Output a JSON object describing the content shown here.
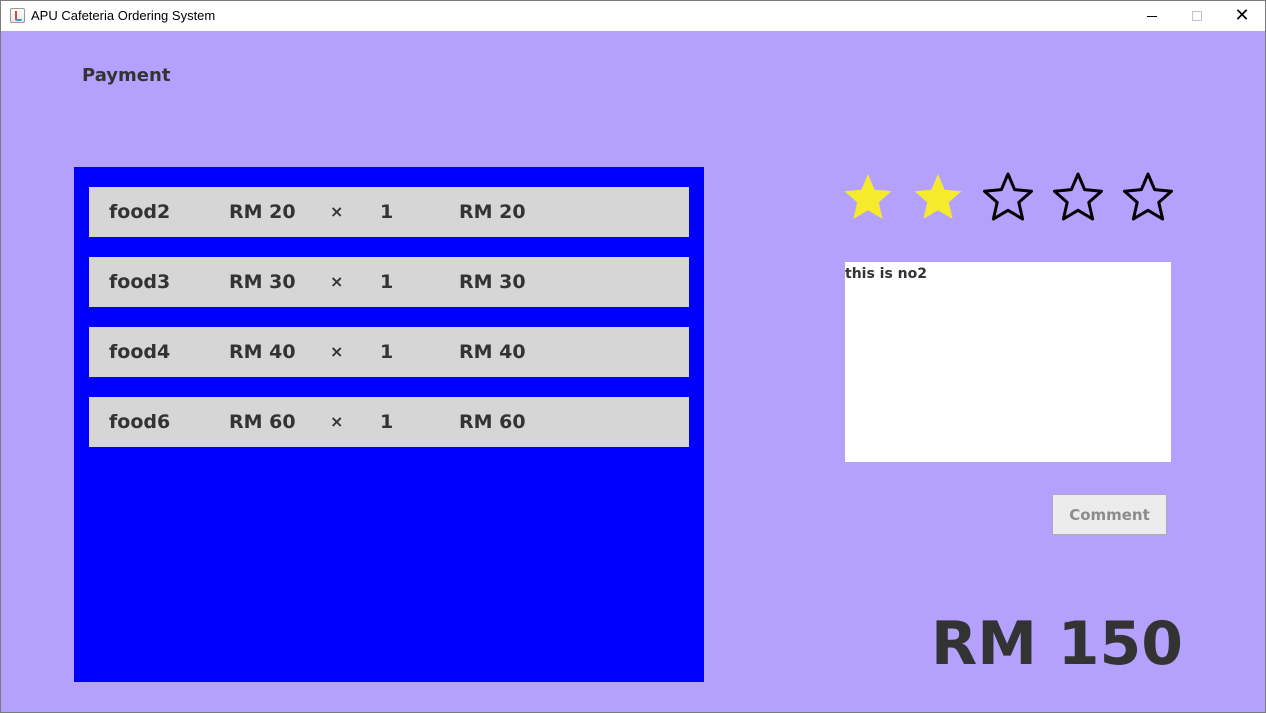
{
  "window": {
    "title": "APU Cafeteria Ordering System",
    "controls": {
      "minimize": "minimize-icon",
      "maximize": "maximize-icon",
      "close": "✕"
    },
    "background_color": "#b3a1fd"
  },
  "page": {
    "title": "Payment"
  },
  "order": {
    "panel_color": "#0000ff",
    "row_color": "#d6d6d6",
    "items": [
      {
        "name": "food2",
        "price": "RM 20",
        "times": "×",
        "qty": "1",
        "subtotal": "RM 20"
      },
      {
        "name": "food3",
        "price": "RM 30",
        "times": "×",
        "qty": "1",
        "subtotal": "RM 30"
      },
      {
        "name": "food4",
        "price": "RM 40",
        "times": "×",
        "qty": "1",
        "subtotal": "RM 40"
      },
      {
        "name": "food6",
        "price": "RM 60",
        "times": "×",
        "qty": "1",
        "subtotal": "RM 60"
      }
    ]
  },
  "rating": {
    "value": 2,
    "max": 5,
    "filled_color": "#f5ea2b",
    "empty_stroke": "#000000"
  },
  "comment": {
    "text": "this is no2",
    "button_label": "Comment"
  },
  "total": {
    "label": "RM 150"
  }
}
